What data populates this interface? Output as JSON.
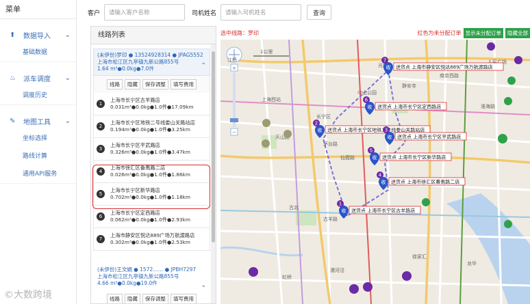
{
  "sidebar": {
    "title": "菜单",
    "groups": [
      {
        "label": "数据导入",
        "items": [
          "基础数据"
        ]
      },
      {
        "label": "派车调度",
        "items": [
          "调度历史"
        ]
      },
      {
        "label": "地图工具",
        "items": [
          "坐标选择",
          "路线计算",
          "通用API服务"
        ]
      }
    ],
    "watermark": "©大数跨境"
  },
  "search": {
    "customer_label": "客户",
    "customer_placeholder": "请输入客户名称",
    "driver_label": "司机姓名",
    "driver_placeholder": "请输入司机姓名",
    "query_button": "查询"
  },
  "route_panel": {
    "title": "线路列表",
    "route1": {
      "line1": "(未伊份)罗印 ● 13524928314 ● JPAG5552",
      "line2": "上海市松江区九亭镇九新公路855号",
      "line3": "1.64 m³●0.0kg●7.0件",
      "actions": [
        "线路",
        "隐藏",
        "保存调整",
        "填写费用"
      ],
      "stops": [
        {
          "num": "1",
          "name": "上海市长宁区古羊路店",
          "info": "0.031m³●0.0kg●1.0件●17.09km"
        },
        {
          "num": "2",
          "name": "上海市长宁区地铁二号线娄山关路站店",
          "info": "0.194m³●0.0kg●1.0件●3.25km"
        },
        {
          "num": "3",
          "name": "上海市长宁区平武路店",
          "info": "0.326m³●0.0kg●1.0件●3.47km"
        },
        {
          "num": "4",
          "name": "上海市徐汇区番禺路二店",
          "info": "0.026m³●0.0kg●1.0件●1.86km"
        },
        {
          "num": "5",
          "name": "上海市长宁区新华路店",
          "info": "0.702m³●0.0kg●1.0件●1.18km"
        },
        {
          "num": "6",
          "name": "上海市长宁区定西路店",
          "info": "0.062m³●0.0kg●1.0件●2.93km"
        },
        {
          "num": "7",
          "name": "上海市静安区悦达889广场万航渡路店",
          "info": "0.302m³●0.0kg●1.0件●2.53km"
        }
      ]
    },
    "route2": {
      "line1": "(未伊份)王文娟 ● 1572…… ● JPBH7297",
      "line2": "上海市松江区九亭镇九新公路855号",
      "line3": "4.66 m³●0.0kg●19.0件",
      "actions": [
        "线路",
        "隐藏",
        "保存调整",
        "填写费用"
      ]
    }
  },
  "map": {
    "selected_label": "选中线路：罗印",
    "hint": "红色为未分配订单",
    "btn_show_unassigned": "显示未分配订单",
    "btn_hide_all": "隐藏全部",
    "scale": "1公里",
    "callout_prefix": "送货点",
    "callouts": [
      {
        "num": "7",
        "text": "送货点 上海市静安区悦达889广场万航渡路店"
      },
      {
        "num": "6",
        "text": "送货点 上海市长宁区定西路店"
      },
      {
        "num": "2",
        "text": "送货点 上海市长宁区地铁二号线娄山关路站店"
      },
      {
        "num": "3",
        "text": "送货点 上海市长宁区平武路店"
      },
      {
        "num": "5",
        "text": "送货点 上海市长宁区新华路店"
      },
      {
        "num": "4",
        "text": "送货点 上海市徐汇区番禺路二店"
      },
      {
        "num": "1",
        "text": "送货点 上海市长宁区古羊路店"
      }
    ],
    "pin_label": "收",
    "place_labels": [
      "江桥",
      "长宁区",
      "天山路",
      "仙霞路",
      "茅台路",
      "古北",
      "虹桥",
      "静安寺",
      "南京西路",
      "人民广场",
      "淮海路",
      "上海西站",
      "徐家汇",
      "漕河泾",
      "龙华",
      "光新路",
      "中山公园",
      "古羊路"
    ],
    "colors": {
      "route": "#7a6fd9",
      "pin": "#2a55c9",
      "callout_border": "#d92b2b"
    }
  }
}
